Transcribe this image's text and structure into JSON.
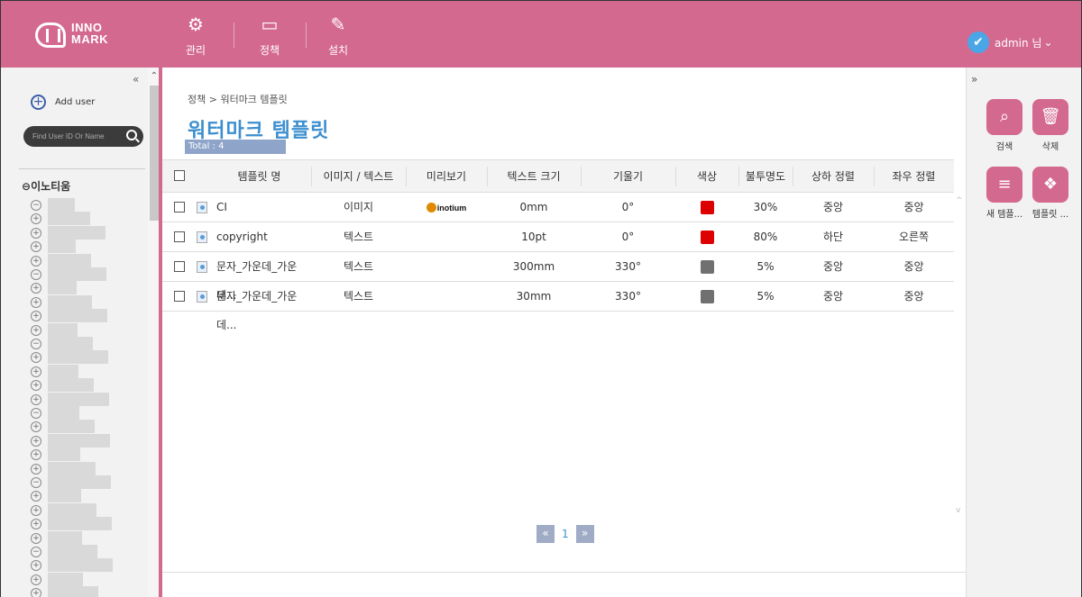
{
  "brand": {
    "line1": "INNO",
    "line2": "MARK"
  },
  "top_menu": [
    {
      "label": "관리",
      "icon": "gears-icon"
    },
    {
      "label": "정책",
      "icon": "monitor-icon"
    },
    {
      "label": "설치",
      "icon": "wand-icon"
    }
  ],
  "user": {
    "label": "admin 님",
    "icon": "wrench-icon"
  },
  "left_panel": {
    "collapse": "«",
    "add_user": "Add user",
    "search_placeholder": "Find User ID Or Name",
    "tree_root": "이노티움"
  },
  "main": {
    "breadcrumb": "정책 > 워터마크 템플릿",
    "title": "워터마크 템플릿",
    "total": "Total : 4",
    "columns": [
      "템플릿 명",
      "이미지 / 텍스트",
      "미리보기",
      "텍스트 크기",
      "기울기",
      "색상",
      "불투명도",
      "상하 정렬",
      "좌우 정렬"
    ],
    "rows": [
      {
        "name": "CI",
        "type": "이미지",
        "preview": "inotium",
        "size": "0mm",
        "tilt": "0°",
        "color": "#dd0000",
        "opacity": "30%",
        "valign": "중앙",
        "halign": "중앙"
      },
      {
        "name": "copyright",
        "type": "텍스트",
        "preview": "",
        "size": "10pt",
        "tilt": "0°",
        "color": "#dd0000",
        "opacity": "80%",
        "valign": "하단",
        "halign": "오른쪽"
      },
      {
        "name": "문자_가운데_가운데...",
        "type": "텍스트",
        "preview": "",
        "size": "300mm",
        "tilt": "330°",
        "color": "#707070",
        "opacity": "5%",
        "valign": "중앙",
        "halign": "중앙"
      },
      {
        "name": "문자_가운데_가운데...",
        "type": "텍스트",
        "preview": "",
        "size": "30mm",
        "tilt": "330°",
        "color": "#707070",
        "opacity": "5%",
        "valign": "중앙",
        "halign": "중앙"
      }
    ],
    "pager": {
      "prev": "«",
      "page": "1",
      "next": "»"
    }
  },
  "right_panel": {
    "collapse": "»",
    "buttons": [
      {
        "label": "검색",
        "icon": "search-icon"
      },
      {
        "label": "삭제",
        "icon": "trash-icon"
      },
      {
        "label": "새 템플...",
        "icon": "add-list-icon"
      },
      {
        "label": "템플릿 ...",
        "icon": "template-icon"
      }
    ]
  },
  "colors": {
    "accent": "#d4698f",
    "title": "#3d8fcf",
    "red": "#dd0000",
    "gray": "#707070"
  }
}
